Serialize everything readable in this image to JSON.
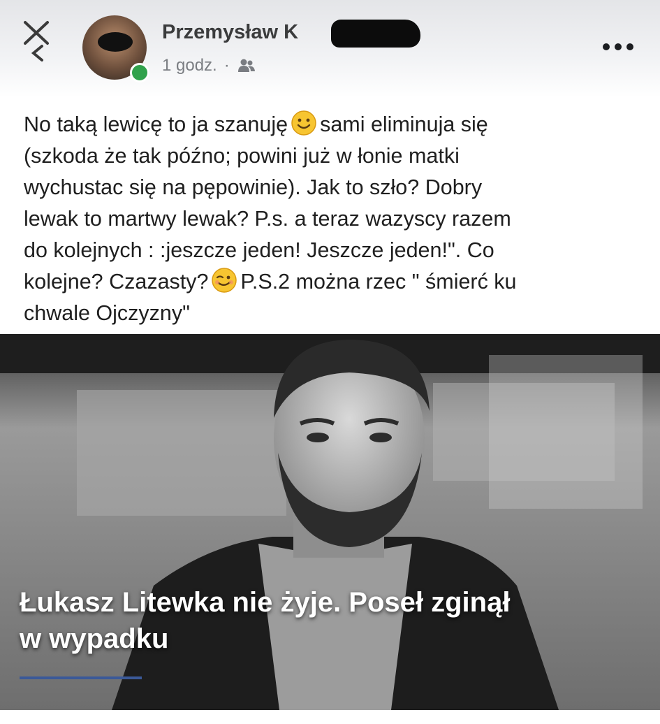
{
  "post": {
    "author_name": "Przemysław K",
    "time": "1 godz.",
    "separator": "·",
    "audience_icon": "friends-icon",
    "text_lines": [
      "No taką lewicę to ja szanuję",
      "sami eliminuja się",
      "(szkoda że tak późno; powini już w łonie matki",
      "wychustac się na pępowinie). Jak to szło? Dobry",
      "lewak to martwy lewak? P.s. a teraz wazyscy razem",
      "do kolejnych : :jeszcze jeden! Jeszcze jeden!\". Co",
      "kolejne? Czazasty?",
      "P.S.2 można rzec \" śmierć ku",
      "chwale Ojczyzny\""
    ],
    "emojis": [
      "slightly-smiling-face-emoji",
      "winking-face-emoji"
    ]
  },
  "link_preview": {
    "headline_line1": "Łukasz Litewka nie żyje. Poseł zginął",
    "headline_line2": "w wypadku",
    "accent_color": "#3b5998"
  },
  "icons": {
    "close": "close-icon",
    "back": "chevron-left-icon",
    "more": "more-options-icon"
  },
  "colors": {
    "online_status": "#31a24c",
    "meta_text": "#7a7d82"
  }
}
